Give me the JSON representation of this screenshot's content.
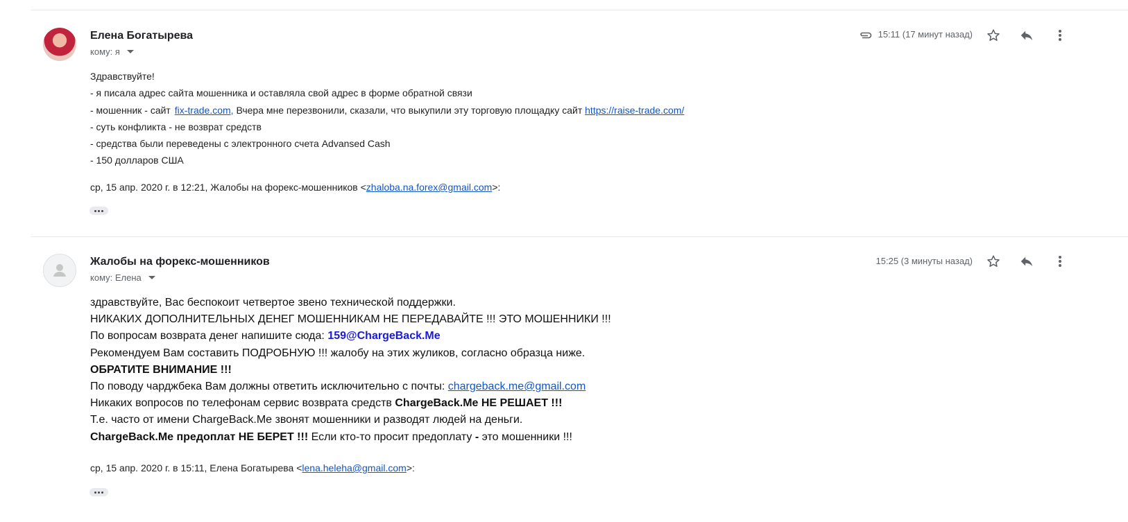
{
  "message1": {
    "sender": "Елена Богатырева",
    "to_label": "кому: я",
    "time": "15:11 (17 минут назад)",
    "lines": [
      {
        "text": "Здравствуйте!"
      },
      {
        "text": "- я писала адрес сайта мошенника и оставляла  свой адрес в форме обратной связи"
      },
      {
        "pre": "- мошенник - сайт ",
        "link1": "fix-trade.com,",
        "mid": " Вчера мне перезвонили, сказали, что выкупили эту торговую площадку сайт ",
        "link2": "https://raise-trade.com/"
      },
      {
        "text": "- суть конфликта - не возврат средств"
      },
      {
        "text": "- средства были переведены с электронного счета Advansed Cash"
      },
      {
        "text": "- 150 долларов США"
      }
    ],
    "quote_pre": "ср, 15 апр. 2020 г. в 12:21, Жалобы на форекс-мошенников <",
    "quote_email": "zhaloba.na.forex@gmail.com",
    "quote_post": ">:"
  },
  "message2": {
    "sender": "Жалобы на форекс-мошенников",
    "to_label": "кому: Елена",
    "time": "15:25 (3 минуты назад)",
    "l1": "здравствуйте, Вас беспокоит четвертое звено технической поддержки.",
    "l2": "НИКАКИХ ДОПОЛНИТЕЛЬНЫХ ДЕНЕГ МОШЕННИКАМ НЕ ПЕРЕДАВАЙТЕ !!! ЭТО МОШЕННИКИ !!!",
    "l3_pre": "По вопросам возврата денег напишите сюда: ",
    "l3_email": "159@ChargeBack.Me",
    "l4": "Рекомендуем Вам составить ПОДРОБНУЮ !!! жалобу на этих жуликов, согласно образца ниже.",
    "l5": "ОБРАТИТЕ ВНИМАНИЕ !!!",
    "l6_pre": "По поводу чарджбека Вам должны ответить исключительно с почты: ",
    "l6_email": "chargeback.me@gmail.com",
    "l7_pre": "Никаких вопросов по телефонам сервис возврата средств ",
    "l7_bold": "ChargeBack.Me НЕ РЕШАЕТ !!!",
    "l8": "Т.е. часто от имени ChargeBack.Me звонят мошенники и разводят людей на деньги.",
    "l9_bold": "ChargeBack.Me предоплат НЕ БЕРЕТ !!!",
    "l9_mid": " Если кто-то просит предоплату ",
    "l9_dash": "-",
    "l9_post": " это мошенники !!!",
    "quote_pre": "ср, 15 апр. 2020 г. в 15:11, Елена Богатырева <",
    "quote_email": "lena.heleha@gmail.com",
    "quote_post": ">:"
  },
  "icons": {
    "attachment": "paperclip-icon",
    "star": "star-icon",
    "reply": "reply-icon",
    "more": "more-vert-icon"
  }
}
